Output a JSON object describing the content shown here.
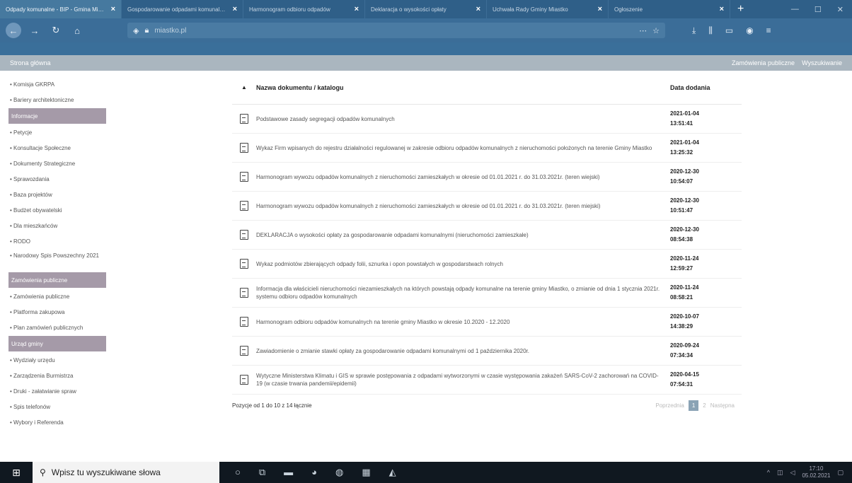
{
  "browser": {
    "tabs": [
      {
        "title": "Odpady komunalne - BIP - Gmina Miastko",
        "active": true
      },
      {
        "title": "Gospodarowanie odpadami komunalnymi",
        "active": false
      },
      {
        "title": "Harmonogram odbioru odpadów",
        "active": false
      },
      {
        "title": "Deklaracja o wysokości opłaty",
        "active": false
      },
      {
        "title": "Uchwała Rady Gminy Miastko",
        "active": false
      },
      {
        "title": "Ogłoszenie",
        "active": false
      }
    ],
    "url": "miastko.pl"
  },
  "site_nav": {
    "home": "Strona główna",
    "right_links": [
      "Zamówienia publiczne",
      "Wyszukiwanie"
    ]
  },
  "sidebar": {
    "items": [
      {
        "type": "link",
        "label": "• Komisja GKRPA"
      },
      {
        "type": "link",
        "label": "• Bariery architektoniczne"
      },
      {
        "type": "header",
        "label": "Informacje"
      },
      {
        "type": "link",
        "label": "• Petycje"
      },
      {
        "type": "link",
        "label": "• Konsultacje Społeczne"
      },
      {
        "type": "link",
        "label": "• Dokumenty Strategiczne"
      },
      {
        "type": "link",
        "label": "• Sprawozdania"
      },
      {
        "type": "link",
        "label": "• Baza projektów"
      },
      {
        "type": "link",
        "label": "• Budżet obywatelski"
      },
      {
        "type": "link",
        "label": "• Dla mieszkańców"
      },
      {
        "type": "link",
        "label": "• RODO"
      },
      {
        "type": "link2",
        "label": "• Narodowy Spis Powszechny 2021"
      },
      {
        "type": "header",
        "label": "Zamówienia publiczne"
      },
      {
        "type": "link",
        "label": "• Zamówienia publiczne"
      },
      {
        "type": "link",
        "label": "• Platforma zakupowa"
      },
      {
        "type": "link",
        "label": "• Plan zamówień publicznych"
      },
      {
        "type": "header",
        "label": "Urząd gminy"
      },
      {
        "type": "link",
        "label": "• Wydziały urzędu"
      },
      {
        "type": "link",
        "label": "• Zarządzenia Burmistrza"
      },
      {
        "type": "link",
        "label": "• Druki - załatwianie spraw"
      },
      {
        "type": "link",
        "label": "• Spis telefonów"
      },
      {
        "type": "link",
        "label": "• Wybory i Referenda"
      }
    ]
  },
  "table": {
    "col_name": "Nazwa dokumentu / katalogu",
    "col_date": "Data dodania",
    "rows": [
      {
        "name": "Podstawowe zasady segregacji odpadów komunalnych",
        "date": "2021-01-04",
        "time": "13:51:41"
      },
      {
        "name": "Wykaz Firm wpisanych do rejestru działalności regulowanej w zakresie odbioru odpadów komunalnych z nieruchomości położonych na terenie Gminy Miastko",
        "date": "2021-01-04",
        "time": "13:25:32"
      },
      {
        "name": "Harmonogram wywozu odpadów komunalnych z nieruchomości zamieszkałych w okresie od 01.01.2021 r. do 31.03.2021r. (teren wiejski)",
        "date": "2020-12-30",
        "time": "10:54:07"
      },
      {
        "name": "Harmonogram wywozu odpadów komunalnych z nieruchomości zamieszkałych w okresie od 01.01.2021 r. do 31.03.2021r. (teren miejski)",
        "date": "2020-12-30",
        "time": "10:51:47"
      },
      {
        "name": "DEKLARACJA o wysokości opłaty za gospodarowanie odpadami komunalnymi (nieruchomości zamieszkałe)",
        "date": "2020-12-30",
        "time": "08:54:38"
      },
      {
        "name": "Wykaz podmiotów zbierających odpady folii, sznurka i opon powstałych w gospodarstwach rolnych",
        "date": "2020-11-24",
        "time": "12:59:27"
      },
      {
        "name": "Informacja dla właścicieli nieruchomości niezamieszkałych na których powstają odpady komunalne na terenie gminy Miastko, o zmianie od dnia 1 stycznia 2021r. systemu odbioru odpadów komunalnych",
        "date": "2020-11-24",
        "time": "08:58:21"
      },
      {
        "name": "Harmonogram odbioru odpadów komunalnych na terenie gminy Miastko w okresie 10.2020 - 12.2020",
        "date": "2020-10-07",
        "time": "14:38:29"
      },
      {
        "name": "Zawiadomienie o zmianie stawki opłaty za gospodarowanie odpadami komunalnymi od 1 października 2020r.",
        "date": "2020-09-24",
        "time": "07:34:34"
      },
      {
        "name": "Wytyczne Ministerstwa Klimatu i GIS w sprawie postępowania z odpadami wytworzonymi w czasie występowania zakażeń SARS-CoV-2 zachorowań na COVID-19 (w czasie trwania pandemii/epidemii)",
        "date": "2020-04-15",
        "time": "07:54:31"
      }
    ],
    "summary": "Pozycje od 1 do 10 z 14 łącznie",
    "pager": {
      "prev": "Poprzednia",
      "current": "1",
      "next_num": "2",
      "next": "Następna"
    }
  },
  "taskbar": {
    "search_placeholder": "Wpisz tu wyszukiwane słowa",
    "time": "17:10",
    "date": "05.02.2021"
  }
}
